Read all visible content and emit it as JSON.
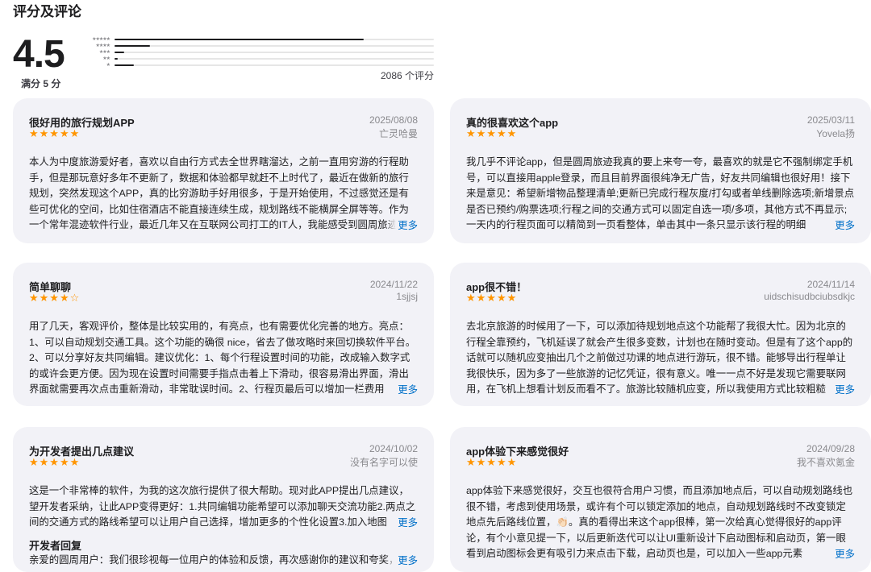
{
  "section": {
    "title": "评分及评论"
  },
  "summary": {
    "average": "4.5",
    "out_of": "满分 5 分",
    "count": "2086 个评分",
    "histogram": [
      {
        "stars": "★★★★★",
        "fraction": 0.78
      },
      {
        "stars": "★★★★",
        "fraction": 0.11
      },
      {
        "stars": "★★★",
        "fraction": 0.03
      },
      {
        "stars": "★★",
        "fraction": 0.01
      },
      {
        "stars": "★",
        "fraction": 0.06
      }
    ]
  },
  "more_label": "更多",
  "reviews": [
    {
      "title": "很好用的旅行规划APP",
      "date": "2025/08/08",
      "author": "亡灵哈曼",
      "stars": "★★★★★",
      "body": "本人为中度旅游爱好者，喜欢以自由行方式去全世界瞎溜达，之前一直用穷游的行程助手，但是那玩意好多年不更新了，数据和体验都早就赶不上时代了，最近在做新的旅行规划，突然发现这个APP，真的比穷游助手好用很多，于是开始使用，不过感觉还是有些可优化的空间，比如住宿酒店不能直接连续生成，规划路线不能横屏全屏等等。作为一个常年混迹软件行业，最近几年又在互联网公司打工的IT人，我能感受到圆周旅迹"
    },
    {
      "title": "真的很喜欢这个app",
      "date": "2025/03/11",
      "author": "Yovela扬",
      "stars": "★★★★★",
      "body": "我几乎不评论app，但是圆周旅迹我真的要上来夸一夸，最喜欢的就是它不强制绑定手机号，可以直接用apple登录，而且目前界面很纯净无广告，好友共同编辑也很好用！接下来是意见：希望新增物品整理清单;更新已完成行程灰度/打勾或者单线删除选项;新增景点是否已预约/购票选项;行程之间的交通方式可以固定自选一项/多项，其他方式不再显示;一天内的行程页面可以精简到一页看整体，单击其中一条只显示该行程的明细"
    },
    {
      "title": "简单聊聊",
      "date": "2024/11/22",
      "author": "1sjjsj",
      "stars": "★★★★☆",
      "body": "用了几天，客观评价，整体是比较实用的，有亮点，也有需要优化完善的地方。亮点：1、可以自动规划交通工具。这个功能的确很 nice，省去了做攻略时来回切换软件平台。2、可以分享好友共同编辑。建议优化：1、每个行程设置时间的功能，改成输入数字式的或许会更方便。因为现在设置时间需要手指点击着上下滑动，很容易滑出界面，滑出界面就需要再次点击重新滑动，非常耽误时间。2、行程页最后可以增加一栏费用"
    },
    {
      "title": "app很不错！",
      "date": "2024/11/14",
      "author": "uidschisudbciubsdkjc",
      "stars": "★★★★★",
      "body": "去北京旅游的时候用了一下，可以添加待规划地点这个功能帮了我很大忙。因为北京的行程全靠预约，飞机延误了就会产生很多变数，计划也在随时变动。但是有了这个app的话就可以随机应变抽出几个之前做过功课的地点进行游玩，很不错。能够导出行程单让我很快乐，因为多了一些旅游的记忆凭证，很有意义。唯一一点不好是发现它需要联网用，在飞机上想看计划反而看不了。旅游比较随机应变，所以我使用方式比较粗糙"
    },
    {
      "title": "为开发者提出几点建议",
      "date": "2024/10/02",
      "author": "没有名字可以使",
      "stars": "★★★★★",
      "body": "这是一个非常棒的软件，为我的这次旅行提供了很大帮助。现对此APP提出几点建议，望开发者采纳，让此APP变得更好：1.共同编辑功能希望可以添加聊天交流功能2.两点之间的交通方式的路线希望可以让用户自己选择，增加更多的个性化设置3.加入地图",
      "dev_title": "开发者回复",
      "dev_body": "亲爱的圆周用户：我们很珍视每一位用户的体验和反馈，再次感谢你的建议和夸奖，"
    },
    {
      "title": "app体验下来感觉很好",
      "date": "2024/09/28",
      "author": "我不喜欢氪金",
      "stars": "★★★★★",
      "body": "app体验下来感觉很好，交互也很符合用户习惯，而且添加地点后，可以自动规划路线也很不错，考虑到使用场景，或许有个可以锁定添加的地点，自动规划路线时不改变锁定地点先后路线位置，👏🏻。真的看得出来这个app很棒，第一次给真心觉得很好的app评论，有个小意见提一下，以后更新迭代可以让UI重新设计下启动图标和启动页，第一眼看到启动图标会更有吸引力来点击下载，启动页也是，可以加入一些app元素"
    }
  ]
}
